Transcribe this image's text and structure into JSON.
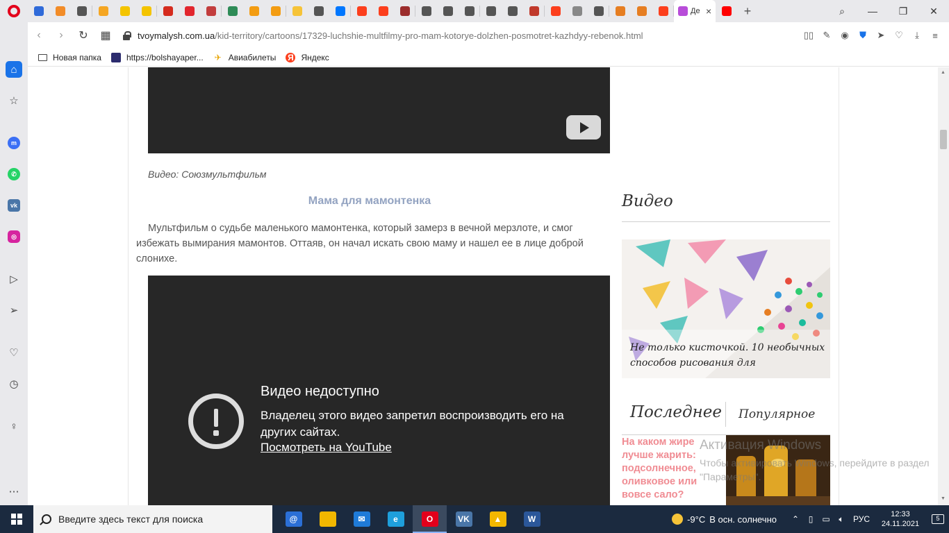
{
  "browser": {
    "active_tab_title": "Де",
    "tab_colors": [
      "#2f6ad9",
      "#f28c28",
      "#555555",
      "#f5a623",
      "#f4c400",
      "#f4c400",
      "#d52b1e",
      "#e2262e",
      "#c23d3d",
      "#2e8b57",
      "#f39c12",
      "#f39c12",
      "#f6c338",
      "#555555",
      "#0077ff",
      "#fc3f1d",
      "#fc3f1d",
      "#9b2c2c",
      "#555555",
      "#555555",
      "#555555",
      "#555555",
      "#555555",
      "#c0392b",
      "#fc3f1d",
      "#888888",
      "#555555",
      "#e67e22",
      "#e67e22",
      "#fc3f1d",
      "#b84dd9",
      "#ff0000"
    ],
    "url_domain": "tvoymalysh.com.ua",
    "url_path": "/kid-territory/cartoons/17329-luchshie-multfilmy-pro-mam-kotorye-dolzhen-posmotret-kazhdyy-rebenok.html",
    "window_controls": {
      "search": "⌕",
      "minimize": "—",
      "restore": "❐",
      "close": "✕"
    }
  },
  "bookmarks": [
    {
      "label": "Новая папка",
      "icon": "folder-icon"
    },
    {
      "label": "https://bolshayaper...",
      "icon": "site-icon"
    },
    {
      "label": "Авиабилеты",
      "icon": "plane-icon"
    },
    {
      "label": "Яндекс",
      "icon": "yandex-icon"
    }
  ],
  "article": {
    "video_caption": "Видео: Союзмультфильм",
    "subheading": "Мама для мамонтенка",
    "paragraph": "Мультфильм о судьбе маленького мамонтенка, который замерз в вечной мерзлоте, и смог избежать вымирания мамонтов. Оттаяв, он начал искать свою маму и нашел ее в лице доброй слонихе.",
    "video_unavailable_title": "Видео недоступно",
    "video_unavailable_msg": "Владелец этого видео запретил воспроизводить его на других сайтах.",
    "video_youtube_link": "Посмотреть на YouTube"
  },
  "aside": {
    "video_heading": "Видео",
    "feature_title": "Не только кисточкой. 10 необычных способов рисования для",
    "tab_latest": "Последнее",
    "tab_popular": "Популярное",
    "news_title": "На каком жире лучше жарить: подсолнечное, оливковое или вовсе сало?"
  },
  "watermark": {
    "line1": "Активация Windows",
    "line2": "Чтобы активировать Windows, перейдите в раздел \"Параметры\"."
  },
  "taskbar": {
    "search_placeholder": "Введите здесь текст для поиска",
    "apps": [
      {
        "label": "@",
        "color": "#2b6fd6"
      },
      {
        "label": "",
        "color": "#f2b700"
      },
      {
        "label": "✉",
        "color": "#1f7bd8"
      },
      {
        "label": "e",
        "color": "#1e9fdc"
      },
      {
        "label": "O",
        "color": "#e3001b"
      },
      {
        "label": "VK",
        "color": "#4a76a8"
      },
      {
        "label": "▲",
        "color": "#f2b700"
      },
      {
        "label": "W",
        "color": "#2b579a"
      }
    ],
    "weather_temp": "-9°C",
    "weather_desc": "В осн. солнечно",
    "language": "РУС",
    "time": "12:33",
    "date": "24.11.2021",
    "notification_count": "5"
  }
}
